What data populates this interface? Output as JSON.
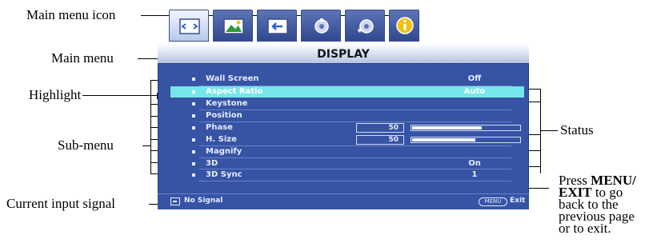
{
  "callouts": {
    "main_menu_icon": "Main menu icon",
    "main_menu": "Main menu",
    "highlight": "Highlight",
    "sub_menu": "Sub-menu",
    "current_input_signal": "Current input signal",
    "status": "Status",
    "press_line1_a": "Press ",
    "press_line1_b": "MENU",
    "press_line1_c": "/",
    "press_line2_a": "EXIT",
    "press_line2_b": " to go",
    "press_line3": "back to the",
    "press_line4": "previous page",
    "press_line5": "or to exit."
  },
  "osd": {
    "tabs": [
      {
        "icon": "display-icon",
        "active": true
      },
      {
        "icon": "picture-icon",
        "active": false
      },
      {
        "icon": "source-icon",
        "active": false
      },
      {
        "icon": "system-setup-basic-icon",
        "active": false
      },
      {
        "icon": "system-setup-advanced-icon",
        "active": false
      },
      {
        "icon": "information-icon",
        "active": false
      }
    ],
    "title": "DISPLAY",
    "items": [
      {
        "label": "Wall Screen",
        "value": "Off"
      },
      {
        "label": "Aspect Ratio",
        "value": "Auto"
      },
      {
        "label": "Keystone",
        "value": ""
      },
      {
        "label": "Position",
        "value": ""
      },
      {
        "label": "Phase",
        "value": "50",
        "level": 0.64
      },
      {
        "label": "H. Size",
        "value": "50",
        "level": 0.58
      },
      {
        "label": "Magnify",
        "value": ""
      },
      {
        "label": "3D",
        "value": "On"
      },
      {
        "label": "3D Sync",
        "value": "1"
      }
    ],
    "footer": {
      "signal": "No Signal",
      "menu_button": "MENU",
      "exit": "Exit"
    }
  },
  "colors": {
    "menu_bg": "#3653a4",
    "highlight": "#75e7ea",
    "title_bar": "#d9e0f2"
  }
}
